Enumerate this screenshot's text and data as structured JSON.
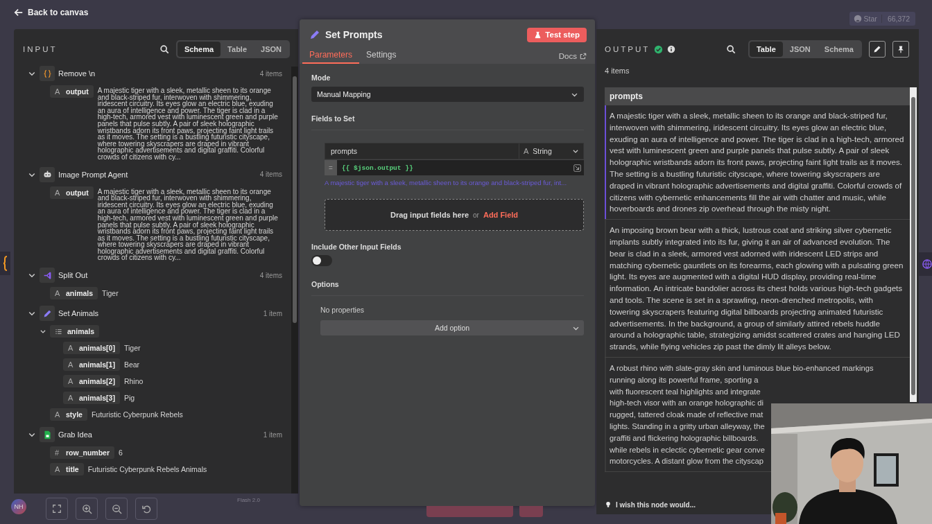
{
  "topbar": {
    "back_label": "Back to canvas",
    "star_label": "Star",
    "star_count": "66,372"
  },
  "input_panel": {
    "title": "INPUT",
    "view_tabs": [
      {
        "label": "Schema",
        "selected": true
      },
      {
        "label": "Table",
        "selected": false
      },
      {
        "label": "JSON",
        "selected": false
      }
    ],
    "nodes": [
      {
        "name": "Remove \\n",
        "kind": "code",
        "count": "4 items",
        "expanded": true,
        "fields": [
          {
            "kind": "text",
            "glyph": "A",
            "name": "output",
            "value": "A majestic tiger with a sleek, metallic sheen to its orange and black-striped fur, interwoven with shimmering, iridescent circuitry. Its eyes glow an electric blue, exuding an aura of intelligence and power. The tiger is clad in a high-tech, armored vest with luminescent green and purple panels that pulse subtly. A pair of sleek holographic wristbands adorn its front paws, projecting faint light trails as it moves. The setting is a bustling futuristic cityscape, where towering skyscrapers are draped in vibrant holographic advertisements and digital graffiti. Colorful crowds of citizens with cy..."
          }
        ]
      },
      {
        "name": "Image Prompt Agent",
        "kind": "agent",
        "count": "4 items",
        "expanded": true,
        "fields": [
          {
            "kind": "text",
            "glyph": "A",
            "name": "output",
            "value": "A majestic tiger with a sleek, metallic sheen to its orange and black-striped fur, interwoven with shimmering, iridescent circuitry. Its eyes glow an electric blue, exuding an aura of intelligence and power. The tiger is clad in a high-tech, armored vest with luminescent green and purple panels that pulse subtly. A pair of sleek holographic wristbands adorn its front paws, projecting faint light trails as it moves. The setting is a bustling futuristic cityscape, where towering skyscrapers are draped in vibrant holographic advertisements and digital graffiti. Colorful crowds of citizens with cy..."
          }
        ]
      },
      {
        "name": "Split Out",
        "kind": "split",
        "count": "4 items",
        "expanded": true,
        "fields": [
          {
            "kind": "text",
            "glyph": "A",
            "name": "animals",
            "value": "Tiger"
          }
        ]
      },
      {
        "name": "Set Animals",
        "kind": "edit",
        "count": "1 item",
        "expanded": true,
        "fields": [
          {
            "kind": "array",
            "name": "animals",
            "expanded": true,
            "children": [
              {
                "kind": "text",
                "glyph": "A",
                "name": "animals[0]",
                "value": "Tiger"
              },
              {
                "kind": "text",
                "glyph": "A",
                "name": "animals[1]",
                "value": "Bear"
              },
              {
                "kind": "text",
                "glyph": "A",
                "name": "animals[2]",
                "value": "Rhino"
              },
              {
                "kind": "text",
                "glyph": "A",
                "name": "animals[3]",
                "value": "Pig"
              }
            ]
          },
          {
            "kind": "text",
            "glyph": "A",
            "name": "style",
            "value": "Futuristic Cyberpunk Rebels"
          }
        ]
      },
      {
        "name": "Grab Idea",
        "kind": "sheet",
        "count": "1 item",
        "expanded": true,
        "fields": [
          {
            "kind": "number",
            "glyph": "#",
            "name": "row_number",
            "value": "6"
          },
          {
            "kind": "text",
            "glyph": "A",
            "name": "title",
            "value": "Futuristic Cyberpunk Rebels Animals"
          }
        ]
      }
    ]
  },
  "parameters_panel": {
    "title": "Set Prompts",
    "test_button": "Test step",
    "tabs": [
      {
        "label": "Parameters",
        "selected": true
      },
      {
        "label": "Settings",
        "selected": false
      }
    ],
    "docs_link": "Docs",
    "mode_label": "Mode",
    "mode_value": "Manual Mapping",
    "fields_label": "Fields to Set",
    "assignment": {
      "name": "prompts",
      "type_glyph": "A",
      "type": "String",
      "mode_glyph": "=",
      "expression": "{{ $json.output }}",
      "preview": "A majestic tiger with a sleek, metallic sheen to its orange and black-striped fur, int..."
    },
    "drop_zone": {
      "text": "Drag input fields here",
      "separator": "or",
      "link": "Add Field"
    },
    "include_label": "Include Other Input Fields",
    "include_on": false,
    "options_label": "Options",
    "options_empty": "No properties",
    "add_option": "Add option"
  },
  "output_panel": {
    "title": "OUTPUT",
    "success": true,
    "view_tabs": [
      {
        "label": "Table",
        "selected": true
      },
      {
        "label": "JSON",
        "selected": false
      },
      {
        "label": "Schema",
        "selected": false
      }
    ],
    "item_count": "4 items",
    "column": "prompts",
    "rows": [
      {
        "kind": "full",
        "selected": true,
        "text": "A majestic tiger with a sleek, metallic sheen to its orange and black-striped fur, interwoven with shimmering, iridescent circuitry. Its eyes glow an electric blue, exuding an aura of intelligence and power. The tiger is clad in a high-tech, armored vest with luminescent green and purple panels that pulse subtly. A pair of sleek holographic wristbands adorn its front paws, projecting faint light trails as it moves. The setting is a bustling futuristic cityscape, where towering skyscrapers are draped in vibrant holographic advertisements and digital graffiti. Colorful crowds of citizens with cybernetic enhancements fill the air with chatter and music, while hoverboards and drones zip overhead through the misty night."
      },
      {
        "kind": "full",
        "selected": false,
        "text": "An imposing brown bear with a thick, lustrous coat and striking silver cybernetic implants subtly integrated into its fur, giving it an air of advanced evolution. The bear is clad in a sleek, armored vest adorned with iridescent LED strips and matching cybernetic gauntlets on its forearms, each glowing with a pulsating green light. Its eyes are augmented with a digital HUD display, providing real-time information. An intricate bandolier across its chest holds various high-tech gadgets and tools. The scene is set in a sprawling, neon-drenched metropolis, with towering skyscrapers featuring digital billboards projecting animated futuristic advertisements. In the background, a group of similarly attired rebels huddle around a holographic table, strategizing amidst scattered crates and hanging LED strands, while flying vehicles zip past the dimly lit alleys below."
      },
      {
        "kind": "clipped",
        "selected": false,
        "lines": [
          "A robust rhino with slate-gray skin and luminous blue bio-enhanced markings",
          "running along its powerful frame, sporting a",
          "with fluorescent teal highlights and integrate",
          "high-tech visor with an orange holographic di",
          "rugged, tattered cloak made of reflective mat",
          "lights. Standing in a gritty urban alleyway, the",
          "graffiti and flickering holographic billboards.",
          "while rebels in eclectic cybernetic gear conve",
          "motorcycles. A distant glow from the cityscap"
        ]
      }
    ],
    "feedback": "I wish this node would..."
  },
  "canvas": {
    "avatar": "NH",
    "model": "Flash 2.0"
  }
}
